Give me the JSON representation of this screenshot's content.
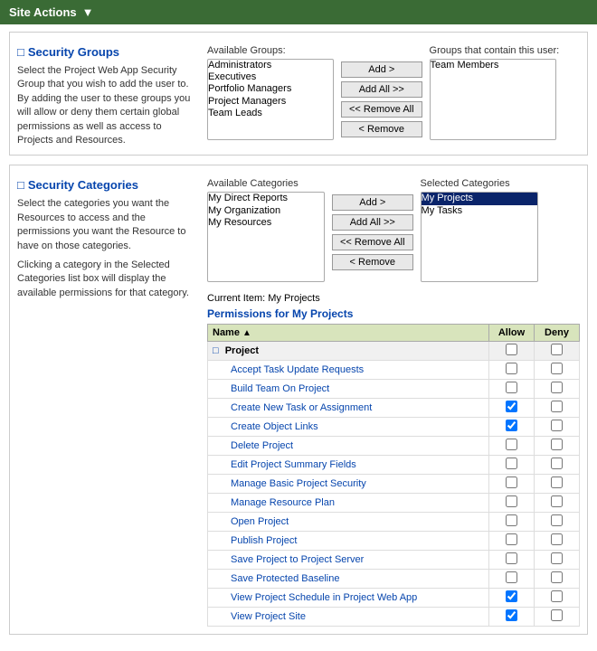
{
  "topbar": {
    "label": "Site Actions",
    "dropdown_label": "▼"
  },
  "security_groups": {
    "title": "Security Groups",
    "description": "Select the Project Web App Security Group that you wish to add the user to. By adding the user to these groups you will allow or deny them certain global permissions as well as access to Projects and Resources.",
    "available_label": "Available Groups:",
    "selected_label": "Groups that contain this user:",
    "available_groups": [
      "Administrators",
      "Executives",
      "Portfolio Managers",
      "Project Managers",
      "Team Leads"
    ],
    "selected_groups": [
      "Team Members"
    ],
    "btn_add": "Add >",
    "btn_add_all": "Add All >>",
    "btn_remove_all": "<< Remove All",
    "btn_remove": "< Remove"
  },
  "security_categories": {
    "title": "Security Categories",
    "description1": "Select the categories you want the Resources to access and the permissions you want the Resource to have on those categories.",
    "description2": "Clicking a category in the Selected Categories list box will display the available permissions for that category.",
    "available_label": "Available Categories",
    "selected_label": "Selected Categories",
    "available_categories": [
      "My Direct Reports",
      "My Organization",
      "My Resources"
    ],
    "selected_categories": [
      "My Projects",
      "My Tasks"
    ],
    "selected_index": 0,
    "btn_add": "Add >",
    "btn_add_all": "Add All >>",
    "btn_remove_all": "<< Remove All",
    "btn_remove": "< Remove",
    "current_item": "Current Item: My Projects",
    "permissions_title": "Permissions for My Projects",
    "perm_table": {
      "col_name": "Name",
      "col_allow": "Allow",
      "col_deny": "Deny",
      "group_label": "Project",
      "permissions": [
        {
          "name": "Accept Task Update Requests",
          "allow": false,
          "deny": false
        },
        {
          "name": "Build Team On Project",
          "allow": false,
          "deny": false
        },
        {
          "name": "Create New Task or Assignment",
          "allow": true,
          "deny": false
        },
        {
          "name": "Create Object Links",
          "allow": true,
          "deny": false
        },
        {
          "name": "Delete Project",
          "allow": false,
          "deny": false
        },
        {
          "name": "Edit Project Summary Fields",
          "allow": false,
          "deny": false
        },
        {
          "name": "Manage Basic Project Security",
          "allow": false,
          "deny": false
        },
        {
          "name": "Manage Resource Plan",
          "allow": false,
          "deny": false
        },
        {
          "name": "Open Project",
          "allow": false,
          "deny": false
        },
        {
          "name": "Publish Project",
          "allow": false,
          "deny": false
        },
        {
          "name": "Save Project to Project Server",
          "allow": false,
          "deny": false
        },
        {
          "name": "Save Protected Baseline",
          "allow": false,
          "deny": false
        },
        {
          "name": "View Project Schedule in Project Web App",
          "allow": true,
          "deny": false
        },
        {
          "name": "View Project Site",
          "allow": true,
          "deny": false
        }
      ]
    }
  }
}
